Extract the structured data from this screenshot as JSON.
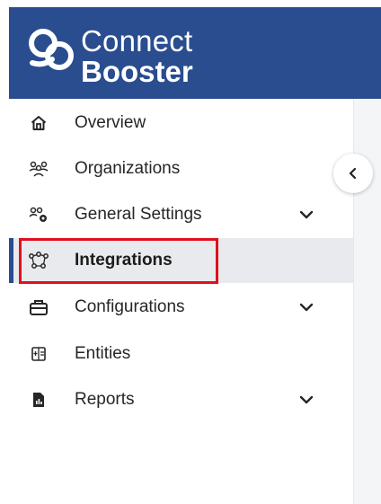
{
  "brand": {
    "line1": "Connect",
    "line2": "Booster",
    "header_color": "#2a4d8f"
  },
  "nav": {
    "items": [
      {
        "label": "Overview",
        "icon": "home-icon",
        "expandable": false,
        "active": false
      },
      {
        "label": "Organizations",
        "icon": "organizations-icon",
        "expandable": false,
        "active": false
      },
      {
        "label": "General Settings",
        "icon": "general-settings-icon",
        "expandable": true,
        "active": false
      },
      {
        "label": "Integrations",
        "icon": "integrations-icon",
        "expandable": false,
        "active": true
      },
      {
        "label": "Configurations",
        "icon": "configurations-icon",
        "expandable": true,
        "active": false
      },
      {
        "label": "Entities",
        "icon": "entities-icon",
        "expandable": false,
        "active": false
      },
      {
        "label": "Reports",
        "icon": "reports-icon",
        "expandable": true,
        "active": false
      }
    ]
  },
  "colors": {
    "accent": "#2a4d8f",
    "highlight_border": "#e0101e",
    "active_bg": "#e9eaed"
  }
}
